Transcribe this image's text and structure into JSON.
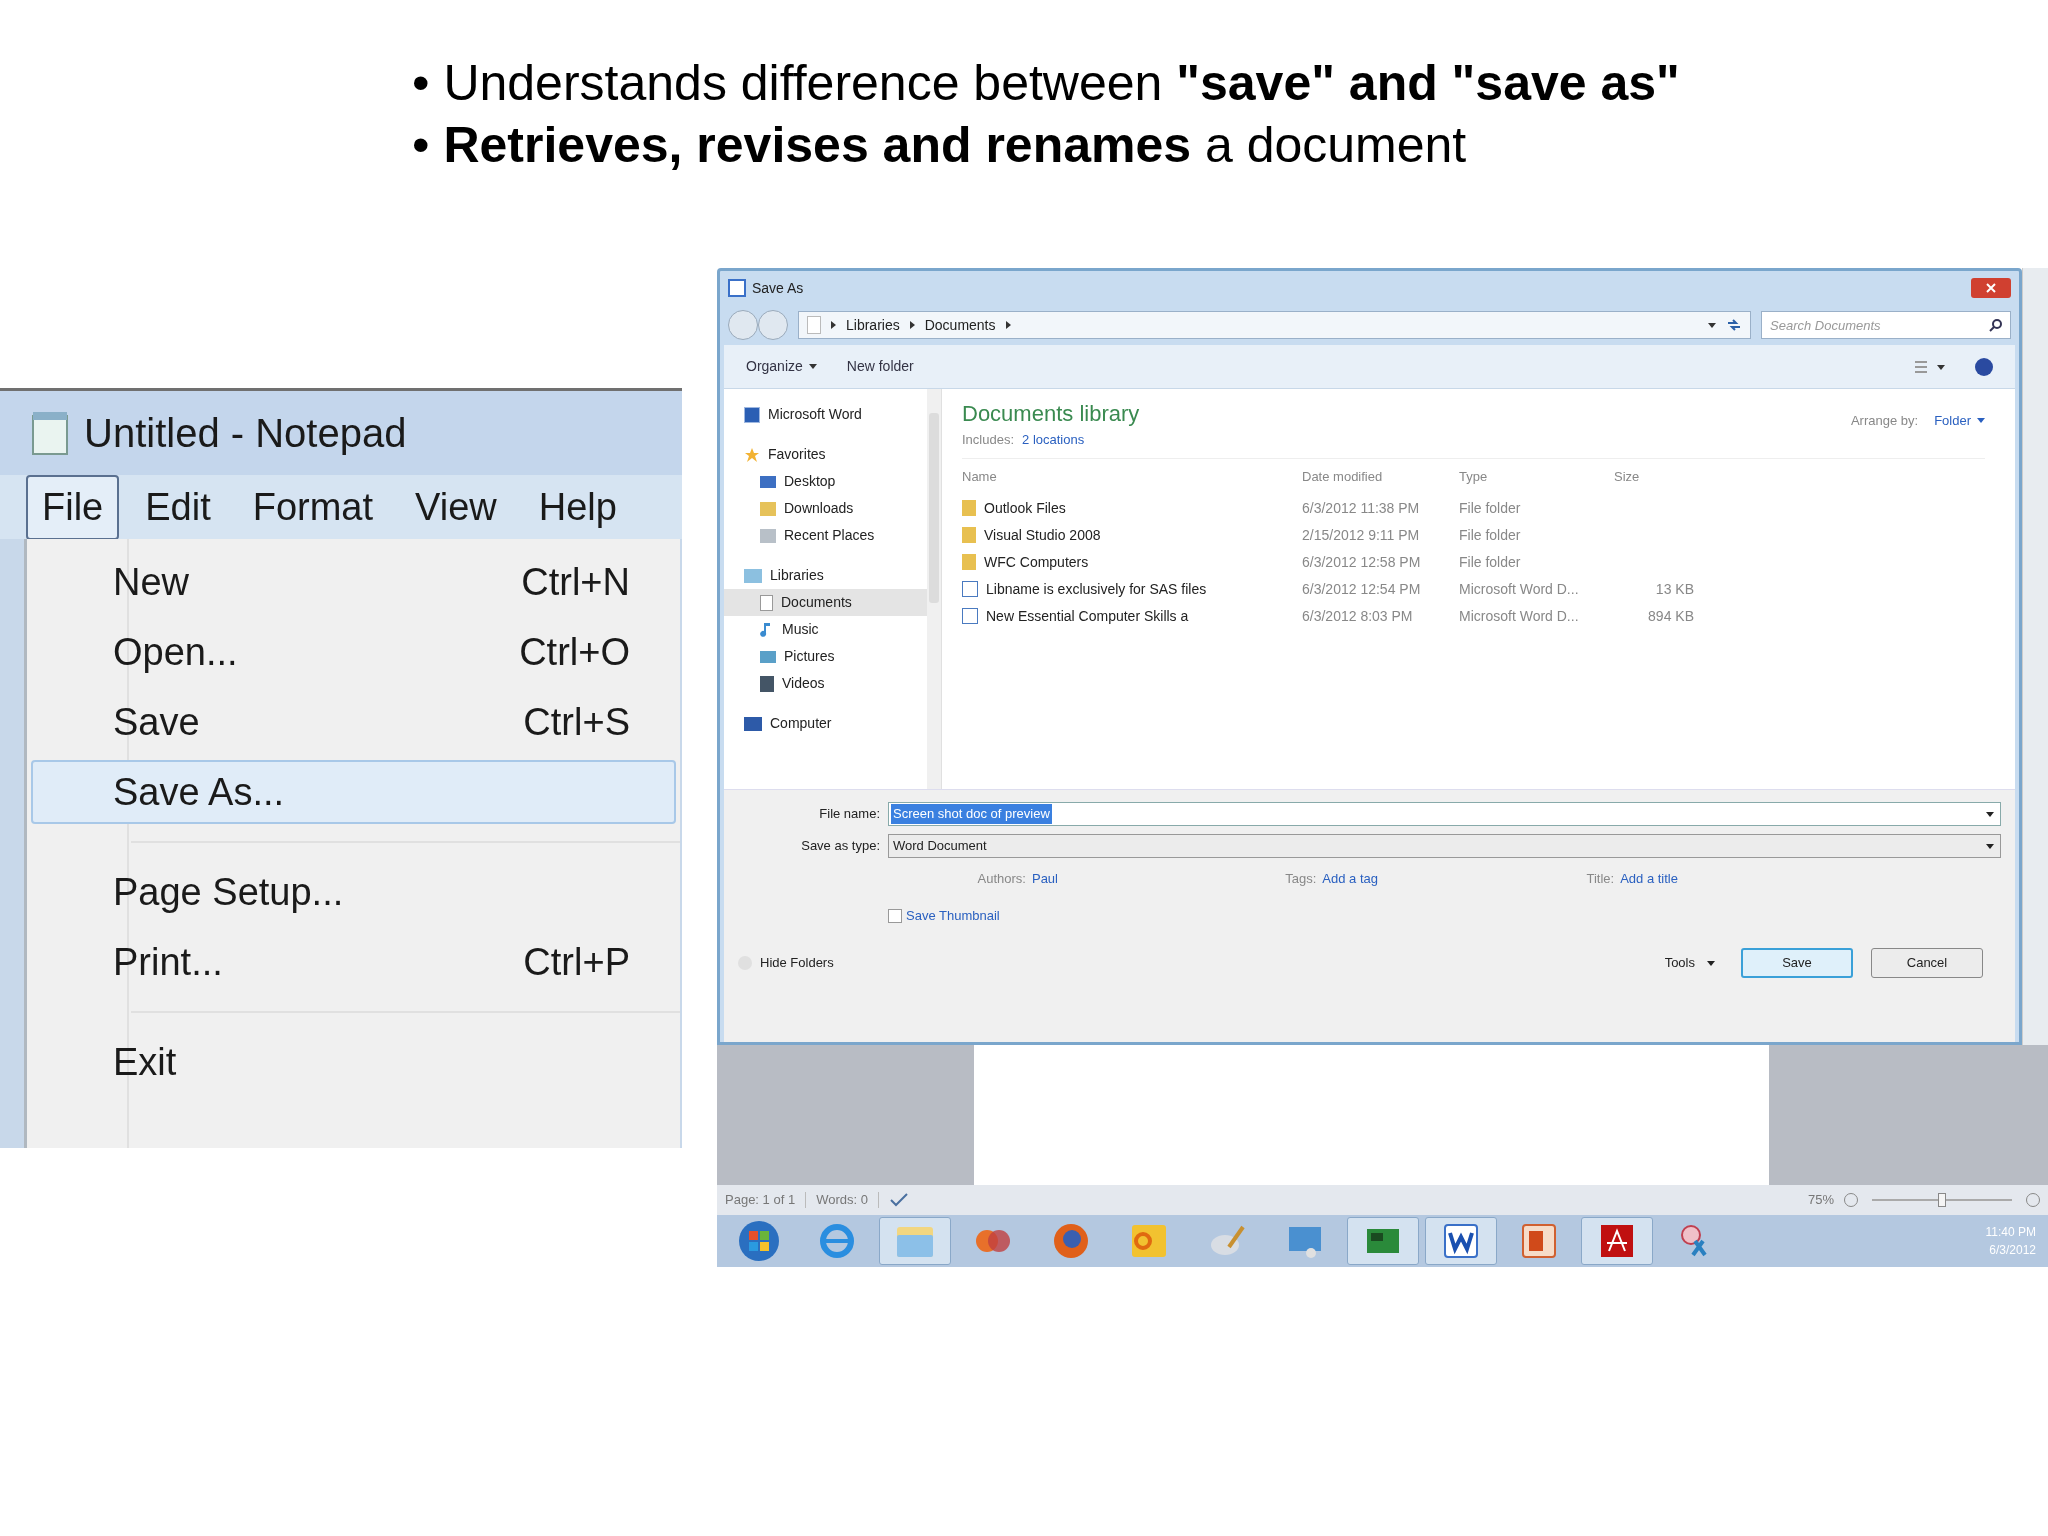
{
  "slide": {
    "bullets": [
      "• Understands difference between **\"save\" and \"save as\"**",
      "• **Retrieves, revises and renames** a document"
    ]
  },
  "notepad": {
    "title": "Untitled - Notepad",
    "menu_bar": [
      {
        "label": "File",
        "selected": true
      },
      {
        "label": "Edit",
        "selected": false
      },
      {
        "label": "Format",
        "selected": false
      },
      {
        "label": "View",
        "selected": false
      },
      {
        "label": "Help",
        "selected": false
      }
    ],
    "menu_items": [
      {
        "kind": "item",
        "label": "New",
        "shortcut": "Ctrl+N",
        "selected": false
      },
      {
        "kind": "item",
        "label": "Open...",
        "shortcut": "Ctrl+O",
        "selected": false
      },
      {
        "kind": "item",
        "label": "Save",
        "shortcut": "Ctrl+S",
        "selected": false
      },
      {
        "kind": "item",
        "label": "Save As...",
        "selected": true
      },
      {
        "kind": "separator"
      },
      {
        "kind": "item",
        "label": "Page Setup...",
        "selected": false
      },
      {
        "kind": "item",
        "label": "Print...",
        "shortcut": "Ctrl+P",
        "selected": false
      },
      {
        "kind": "separator"
      },
      {
        "kind": "item",
        "label": "Exit",
        "selected": false
      }
    ]
  },
  "save_dialog": {
    "title": "Save As",
    "breadcrumb": [
      "Libraries",
      "Documents"
    ],
    "search": {
      "placeholder": "Search Documents"
    },
    "toolbar": {
      "organize": "Organize",
      "new_folder": "New folder"
    },
    "nav": [
      {
        "kind": "word",
        "label": "Microsoft Word",
        "selected": false
      },
      {
        "kind": "star",
        "label": "Favorites",
        "selected": false,
        "children": [
          {
            "kind": "desktop",
            "label": "Desktop",
            "selected": false
          },
          {
            "kind": "downloads",
            "label": "Downloads",
            "selected": false
          },
          {
            "kind": "recent",
            "label": "Recent Places",
            "selected": false
          }
        ]
      },
      {
        "kind": "library",
        "label": "Libraries",
        "selected": false,
        "children": [
          {
            "kind": "document",
            "label": "Documents",
            "selected": true
          },
          {
            "kind": "music",
            "label": "Music",
            "selected": false
          },
          {
            "kind": "pictures",
            "label": "Pictures",
            "selected": false
          },
          {
            "kind": "videos",
            "label": "Videos",
            "selected": false
          }
        ]
      },
      {
        "kind": "computer",
        "label": "Computer",
        "selected": false
      }
    ],
    "library": {
      "title": "Documents library",
      "includes_label": "Includes:",
      "includes_link": "2 locations",
      "arrange_label": "Arrange by:",
      "arrange_value": "Folder"
    },
    "columns": [
      "Name",
      "Date modified",
      "Type",
      "Size"
    ],
    "rows": [
      {
        "kind": "folder",
        "name": "Outlook Files",
        "date": "6/3/2012 11:38 PM",
        "type": "File folder"
      },
      {
        "kind": "folder",
        "name": "Visual Studio 2008",
        "date": "2/15/2012 9:11 PM",
        "type": "File folder"
      },
      {
        "kind": "folder",
        "name": "WFC Computers",
        "date": "6/3/2012 12:58 PM",
        "type": "File folder"
      },
      {
        "kind": "file",
        "name": "Libname is exclusively for SAS files",
        "date": "6/3/2012 12:54 PM",
        "type": "Microsoft Word D...",
        "size": "13 KB"
      },
      {
        "kind": "file",
        "name": "New Essential Computer Skills a",
        "date": "6/3/2012 8:03 PM",
        "type": "Microsoft Word D...",
        "size": "894 KB"
      }
    ],
    "file_name": {
      "label": "File name:",
      "value": "Screen shot doc of preview"
    },
    "save_as_type": {
      "label": "Save as type:",
      "value": "Word Document"
    },
    "authors": {
      "label": "Authors:",
      "value": "Paul"
    },
    "tags": {
      "label": "Tags:",
      "value": "Add a tag"
    },
    "doc_title": {
      "label": "Title:",
      "value": "Add a title"
    },
    "save_thumbnail": {
      "label": "Save Thumbnail",
      "checked": false
    },
    "hide_folders": "Hide Folders",
    "tools": "Tools",
    "buttons": [
      "Save",
      "Cancel"
    ]
  },
  "word_status": {
    "page": "Page: 1 of 1",
    "words": "Words: 0",
    "zoom": "75%",
    "zoom_level": {
      "level": 0.5
    }
  },
  "taskbar": {
    "apps": [
      {
        "kind": "start",
        "open": false
      },
      {
        "kind": "browser",
        "open": false
      },
      {
        "kind": "explorer",
        "open": true
      },
      {
        "kind": "media",
        "open": false
      },
      {
        "kind": "firefox",
        "open": false
      },
      {
        "kind": "outlook",
        "open": false
      },
      {
        "kind": "paint",
        "open": false
      },
      {
        "kind": "network",
        "open": false
      },
      {
        "kind": "board",
        "open": true
      },
      {
        "kind": "word",
        "open": true
      },
      {
        "kind": "powerpoint",
        "open": false
      },
      {
        "kind": "acrobat",
        "open": true
      },
      {
        "kind": "snip",
        "open": false
      }
    ],
    "time": "11:40 PM",
    "date": "6/3/2012"
  }
}
